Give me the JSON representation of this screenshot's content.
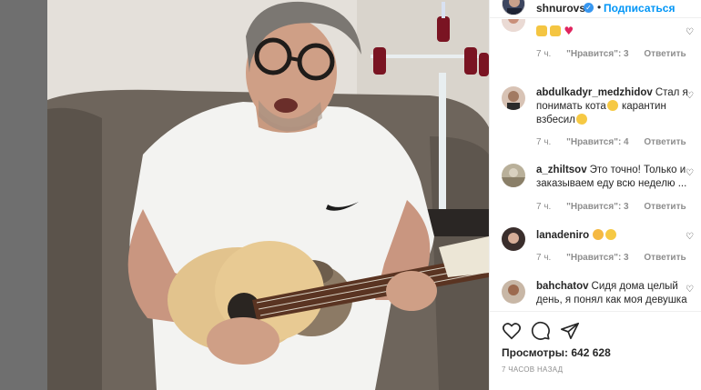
{
  "header": {
    "username": "shnurovs",
    "separator": "•",
    "follow_label": "Подписаться"
  },
  "comments": [
    {
      "user": "",
      "text": "",
      "emojis": [
        "thumbs-up",
        "thumbs-up",
        "red-heart"
      ],
      "time": "7 ч.",
      "likes": "\"Нравится\": 3",
      "reply": "Ответить"
    },
    {
      "user": "abdulkadyr_medzhidov",
      "text_part1": "Стал я понимать кота",
      "text_part2": " карантин взбесил",
      "emojis": [
        "tears-of-joy",
        "tears-of-joy"
      ],
      "time": "7 ч.",
      "likes": "\"Нравится\": 4",
      "reply": "Ответить"
    },
    {
      "user": "a_zhiltsov",
      "text": "Это точно! Только и заказываем еду всю неделю ...",
      "time": "7 ч.",
      "likes": "\"Нравится\": 3",
      "reply": "Ответить"
    },
    {
      "user": "lanadeniro",
      "text": "",
      "emojis": [
        "star-struck",
        "grinning"
      ],
      "time": "7 ч.",
      "likes": "\"Нравится\": 3",
      "reply": "Ответить"
    },
    {
      "user": "bahchatov",
      "text": "Сидя дома целый день, я понял как моя девушка"
    }
  ],
  "actions": {
    "views_label": "Просмотры:",
    "views_count": "642 628",
    "time_ago": "7 ЧАСОВ НАЗАД"
  },
  "colors": {
    "accent": "#0095f6",
    "verified": "#3897f0",
    "muted_text": "#8e8e8e",
    "heart": "#ed4956"
  }
}
